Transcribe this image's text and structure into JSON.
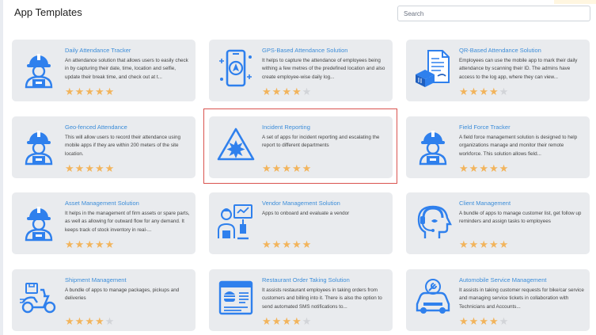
{
  "page": {
    "title": "App Templates"
  },
  "search": {
    "placeholder": "Search"
  },
  "colors": {
    "card_bg": "#e9ebee",
    "title": "#3c8dd9",
    "star_on": "#f2b45c",
    "star_off": "#d2d4d8",
    "icon": "#2f80ed",
    "highlight": "#d9534f"
  },
  "cards": [
    {
      "title": "Daily Attendance Tracker",
      "description": "An attendance solution that allows users to easily check in by capturing their date, time, location and selfie, update their break time, and check out at t...",
      "rating": 5,
      "icon": "worker-icon"
    },
    {
      "title": "GPS-Based Attendance Solution",
      "description": "It helps to capture the attendance of employees being withing a few metres of the predefined location and also create employee-wise daily log...",
      "rating": 4,
      "icon": "gps-phone-icon"
    },
    {
      "title": "QR-Based Attendance Solution",
      "description": "Employees can use the mobile app to mark their daily attendance by scanning their ID. The admins have access to the log app, where they can view...",
      "rating": 4,
      "icon": "qr-document-icon"
    },
    {
      "title": "Geo-fenced Attendance",
      "description": "This will allow users to record their attendance using mobile apps if they are within 200 meters of the site location.",
      "rating": 5,
      "icon": "worker-icon"
    },
    {
      "title": "Incident Reporting",
      "description": "A set of apps for incident reporting and escalating the report to different departments",
      "rating": 5,
      "icon": "hazard-icon"
    },
    {
      "title": "Field Force Tracker",
      "description": "A field force management solution is designed to help organizations manage and monitor their remote workforce. This solution allows field...",
      "rating": 5,
      "icon": "worker-icon"
    },
    {
      "title": "Asset Management Solution",
      "description": "It helps in the management of firm assets or spare parts, as well as allowing for outward flow for any demand. It keeps track of stock inventory in real-...",
      "rating": 5,
      "icon": "worker-icon"
    },
    {
      "title": "Vendor Management Solution",
      "description": "Apps to onboard and evaluate a vendor",
      "rating": 5,
      "icon": "vendor-icon"
    },
    {
      "title": "Client Management",
      "description": "A bundle of apps to manage customer list, get follow up reminders and assign tasks to employees",
      "rating": 5,
      "icon": "headset-head-icon"
    },
    {
      "title": "Shipment Management",
      "description": "A bundle of apps to manage packages, pickups and deliveries",
      "rating": 4,
      "icon": "delivery-scooter-icon"
    },
    {
      "title": "Restaurant Order Taking Solution",
      "description": "It assists restaurant employees in taking orders from customers and billing into it. There is also the option to send automated SMS notifications to...",
      "rating": 4,
      "icon": "restaurant-menu-icon"
    },
    {
      "title": "Automobile Service Management",
      "description": "It assists in taking customer requests for bike/car service and managing service tickets in collaboration with Technicians and Accounts...",
      "rating": 4,
      "icon": "car-service-icon"
    }
  ]
}
